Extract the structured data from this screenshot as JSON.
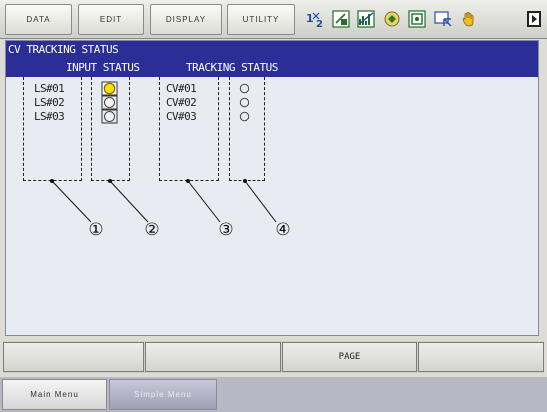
{
  "top_menu": {
    "data": "DATA",
    "edit": "EDIT",
    "display": "DISPLAY",
    "utility": "UTILITY"
  },
  "status_icons": [
    "one-two-icon",
    "edit-status-icon",
    "chart-icon",
    "run-icon",
    "tool-icon",
    "cursor-icon",
    "hand-icon",
    "page-marker-icon"
  ],
  "panel": {
    "title": "CV TRACKING STATUS",
    "input_header": "INPUT STATUS",
    "tracking_header": "TRACKING STATUS",
    "limit_switches": [
      {
        "label": "LS#01",
        "state": "on"
      },
      {
        "label": "LS#02",
        "state": "off"
      },
      {
        "label": "LS#03",
        "state": "off"
      }
    ],
    "conveyors": [
      {
        "label": "CV#01",
        "state": "off"
      },
      {
        "label": "CV#02",
        "state": "off"
      },
      {
        "label": "CV#03",
        "state": "off"
      }
    ],
    "callouts": [
      "①",
      "②",
      "③",
      "④"
    ]
  },
  "function_keys": [
    "",
    "",
    "PAGE",
    ""
  ],
  "bottom_menu": {
    "main": "Main Menu",
    "simple": "Simple Menu"
  },
  "colors": {
    "header_bg": "#2a2e96",
    "lamp_on": "#ffe000",
    "panel_bg": "#e8ebf2"
  }
}
